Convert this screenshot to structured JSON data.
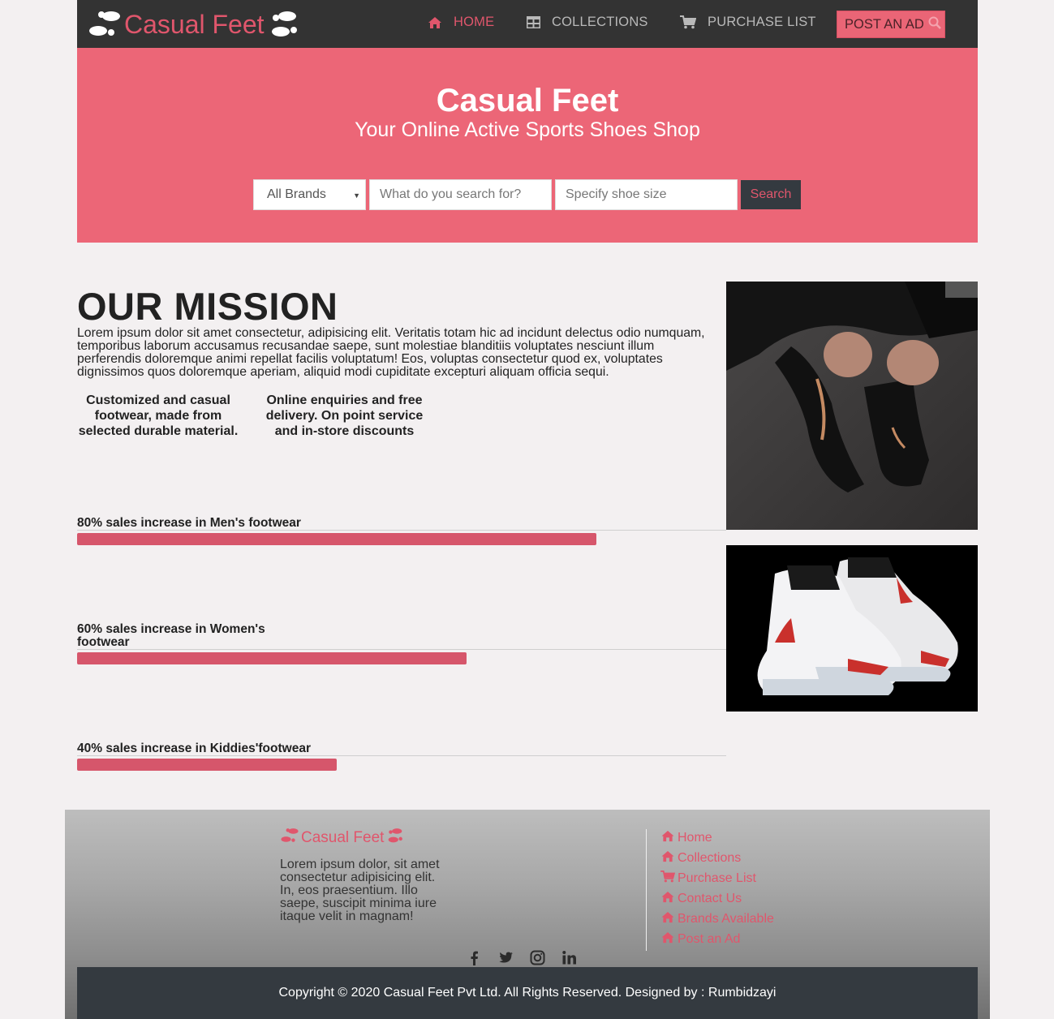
{
  "nav": {
    "brand": "Casual Feet",
    "items": [
      {
        "label": "HOME",
        "icon": "home-icon"
      },
      {
        "label": "COLLECTIONS",
        "icon": "table-icon"
      },
      {
        "label": "PURCHASE LIST",
        "icon": "cart-icon"
      }
    ],
    "post_ad": "POST AN AD"
  },
  "hero": {
    "title": "Casual Feet",
    "subtitle": "Your Online Active Sports Shoes Shop",
    "brand_select": "All Brands",
    "search_placeholder": "What do you search for?",
    "size_placeholder": "Specify shoe size",
    "search_button": "Search"
  },
  "mission": {
    "title": "OUR MISSION",
    "text": "Lorem ipsum dolor sit amet consectetur, adipisicing elit. Veritatis totam hic ad incidunt delectus odio numquam, temporibus laborum accusamus recusandae saepe, sunt molestiae blanditiis voluptates nesciunt illum perferendis doloremque animi repellat facilis voluptatum! Eos, voluptas consectetur quod ex, voluptates dignissimos quos doloremque aperiam, aliquid modi cupiditate excepturi aliquam officia sequi.",
    "features": [
      "Customized and casual footwear, made from selected durable material.",
      "Online enquiries and free delivery. On point service and in-store discounts"
    ],
    "stats": [
      {
        "label": "80% sales increase in Men's footwear",
        "percent": 80
      },
      {
        "label": "60% sales increase in Women's footwear",
        "percent": 60
      },
      {
        "label": "40% sales increase in Kiddies'footwear",
        "percent": 40
      }
    ]
  },
  "footer": {
    "brand": "Casual Feet",
    "text": "Lorem ipsum dolor, sit amet consectetur adipisicing elit. In, eos praesentium. Illo saepe, suscipit minima iure itaque velit in magnam!",
    "links": [
      {
        "label": "Home",
        "icon": "home-icon"
      },
      {
        "label": "Collections",
        "icon": "home-icon"
      },
      {
        "label": "Purchase List",
        "icon": "cart-icon"
      },
      {
        "label": "Contact Us",
        "icon": "home-icon"
      },
      {
        "label": "Brands Available",
        "icon": "home-icon"
      },
      {
        "label": "Post an Ad",
        "icon": "home-icon"
      }
    ],
    "social": [
      "facebook-icon",
      "twitter-icon",
      "instagram-icon",
      "linkedin-icon"
    ],
    "copyright": "Copyright © 2020 Casual Feet Pvt Ltd. All Rights Reserved. Designed by : Rumbidzayi"
  },
  "colors": {
    "accent": "#e0566c",
    "hero": "#ec6677",
    "dark": "#333333",
    "bar": "#d6566b"
  }
}
